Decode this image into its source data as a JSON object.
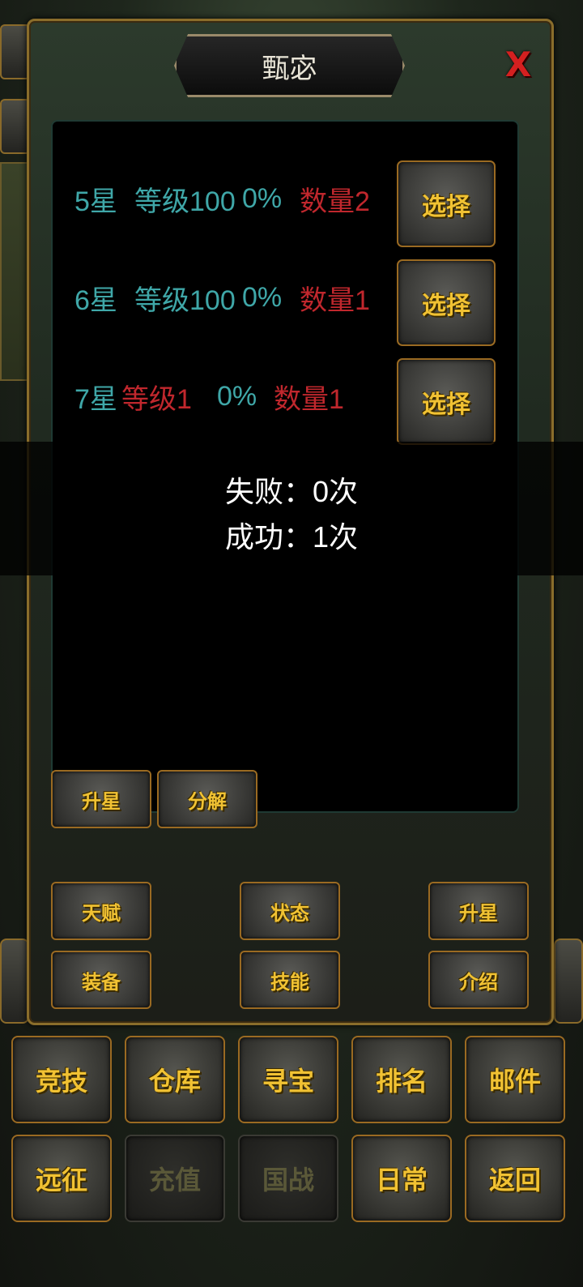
{
  "dialog": {
    "title": "甄宓",
    "close_label": "X"
  },
  "rows": [
    {
      "star": "5星",
      "level": "等级100",
      "percent": "0%",
      "count": "数量2",
      "select_label": "选择"
    },
    {
      "star": "6星",
      "level": "等级100",
      "percent": "0%",
      "count": "数量1",
      "select_label": "选择"
    },
    {
      "star": "7星",
      "level": "等级1",
      "percent": "0%",
      "count": "数量1",
      "select_label": "选择"
    }
  ],
  "result": {
    "fail": "失败：0次",
    "success": "成功：1次"
  },
  "actions": {
    "upgrade_star": "升星",
    "decompose": "分解"
  },
  "panel_buttons": {
    "talent": "天赋",
    "status": "状态",
    "upgrade_star": "升星",
    "equipment": "装备",
    "skill": "技能",
    "intro": "介绍"
  },
  "bottom_nav": {
    "arena": "竞技",
    "warehouse": "仓库",
    "treasure": "寻宝",
    "ranking": "排名",
    "mail": "邮件",
    "expedition": "远征",
    "recharge": "充值",
    "nation_war": "国战",
    "daily": "日常",
    "back": "返回"
  },
  "colors": {
    "teal": "#3fa7a8",
    "red": "#c0272d",
    "gold": "#f1c233"
  }
}
